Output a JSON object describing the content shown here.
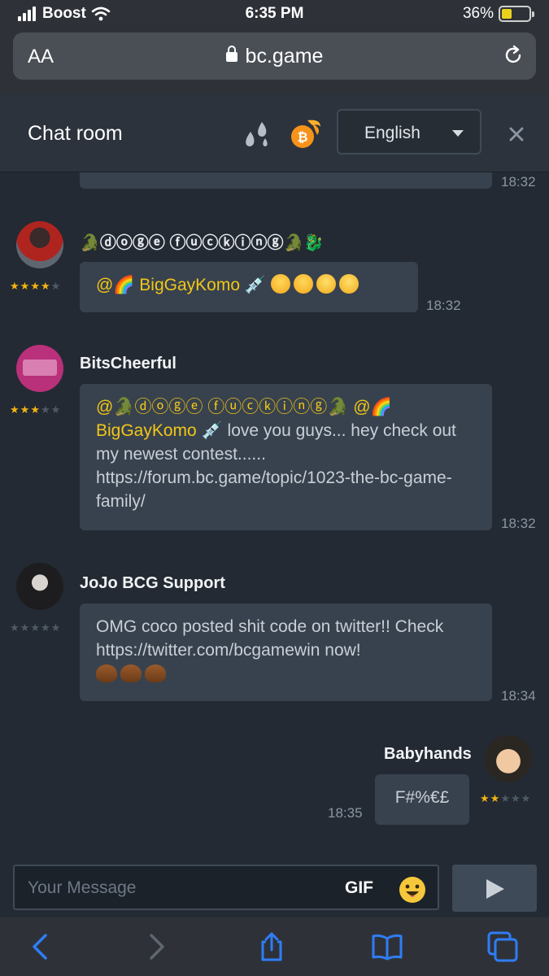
{
  "status": {
    "carrier": "Boost",
    "time": "6:35 PM",
    "battery": "36%",
    "battery_level": 0.36
  },
  "browser": {
    "text_size": "AA",
    "url": "bc.game"
  },
  "header": {
    "title": "Chat room",
    "language": "English"
  },
  "messages": [
    {
      "partial": true,
      "time": "18:32"
    },
    {
      "username": "🐊ⓓⓞⓖⓔ ⓕⓤⓒⓚⓘⓝⓖ🐊🐉",
      "stars": 3.5,
      "mention": "@🌈 BigGayKomo",
      "text": "💉",
      "time": "18:32"
    },
    {
      "username": "BitsCheerful",
      "stars": 2.5,
      "mention1": "@🐊ⓓⓞⓖⓔ ⓕⓤⓒⓚⓘⓝⓖ🐊",
      "mention2": "@🌈 BigGayKomo",
      "text": "💉 love you guys... hey check out my newest contest...... https://forum.bc.game/topic/1023-the-bc-game-family/",
      "time": "18:32"
    },
    {
      "username": "JoJo BCG Support",
      "stars": 0,
      "text": "OMG coco posted shit code on twitter!! Check https://twitter.com/bcgamewin now!",
      "time": "18:34"
    },
    {
      "username": "Babyhands",
      "stars": 2,
      "text": "F#%€£",
      "time": "18:35",
      "own": true
    }
  ],
  "composer": {
    "placeholder": "Your Message",
    "gif_label": "GIF"
  },
  "icons": [
    "signal-icon",
    "wifi-icon",
    "lock-icon",
    "reload-icon",
    "rain-icon",
    "bitcoin-coin-icon",
    "close-icon",
    "smiley-icon",
    "send-icon",
    "back-icon",
    "forward-icon",
    "share-icon",
    "bookmarks-icon",
    "tabs-icon"
  ],
  "colors": {
    "accent_yellow": "#f2c617",
    "bubble": "#38424e",
    "ios_blue": "#2f7df6"
  }
}
